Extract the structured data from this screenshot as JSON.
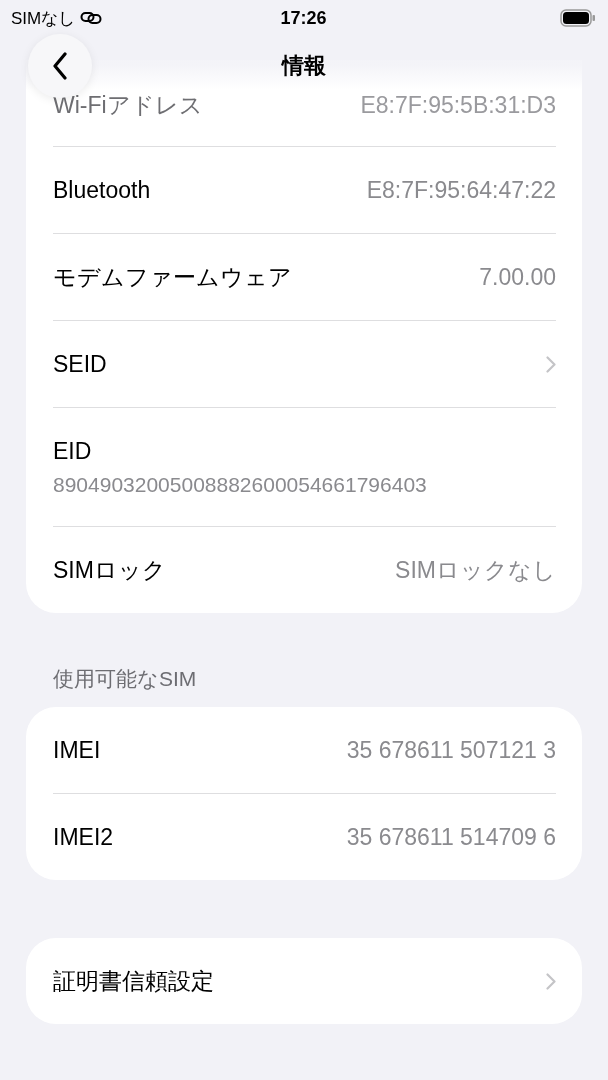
{
  "status_bar": {
    "carrier": "SIMなし",
    "time": "17:26"
  },
  "nav": {
    "title": "情報"
  },
  "groups": [
    {
      "rows": [
        {
          "kind": "dimmed",
          "label": "Wi-Fiアドレス",
          "value": "E8:7F:95:5B:31:D3"
        },
        {
          "kind": "value",
          "label": "Bluetooth",
          "value": "E8:7F:95:64:47:22"
        },
        {
          "kind": "value",
          "label": "モデムファームウェア",
          "value": "7.00.00"
        },
        {
          "kind": "link",
          "label": "SEID"
        },
        {
          "kind": "stacked",
          "label": "EID",
          "value": "89049032005008882600054661796403"
        },
        {
          "kind": "value",
          "label": "SIMロック",
          "value": "SIMロックなし"
        }
      ]
    },
    {
      "header": "使用可能なSIM",
      "rows": [
        {
          "kind": "value",
          "label": "IMEI",
          "value": "35 678611 507121 3"
        },
        {
          "kind": "value",
          "label": "IMEI2",
          "value": "35 678611 514709 6"
        }
      ]
    },
    {
      "rows": [
        {
          "kind": "link",
          "label": "証明書信頼設定"
        }
      ]
    }
  ]
}
